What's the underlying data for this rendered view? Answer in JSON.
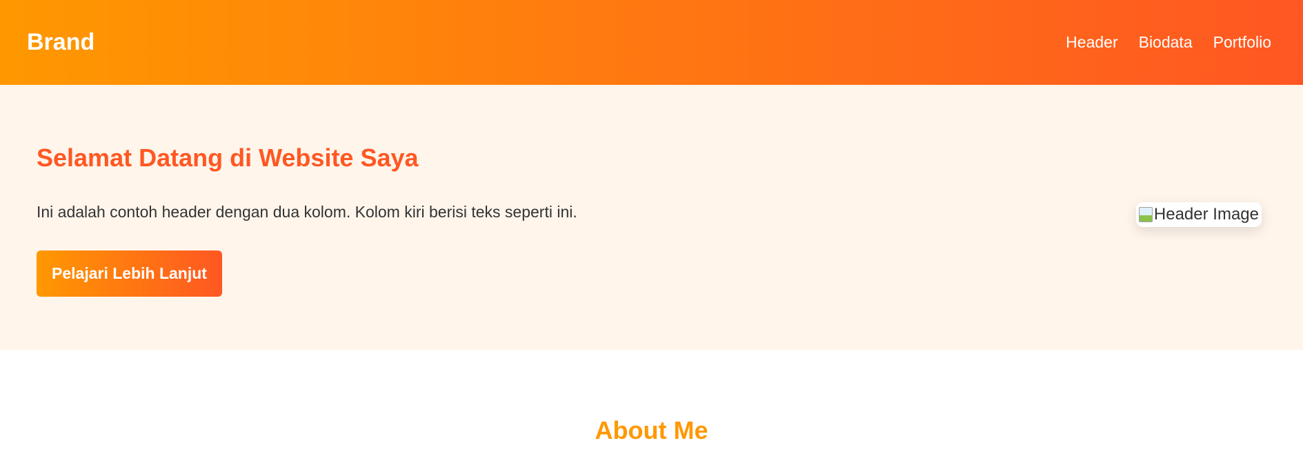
{
  "navbar": {
    "brand": "Brand",
    "links": [
      {
        "label": "Header"
      },
      {
        "label": "Biodata"
      },
      {
        "label": "Portfolio"
      }
    ]
  },
  "hero": {
    "title": "Selamat Datang di Website Saya",
    "description": "Ini adalah contoh header dengan dua kolom. Kolom kiri berisi teks seperti ini.",
    "button_label": "Pelajari Lebih Lanjut",
    "image_alt": "Header Image",
    "broken_image_icon": "broken-image-icon"
  },
  "about": {
    "title": "About Me"
  },
  "colors": {
    "gradient_start": "#ff9800",
    "gradient_end": "#ff5722",
    "hero_background": "#fff5eb",
    "hero_title": "#ff5722",
    "about_title": "#ff9800"
  }
}
